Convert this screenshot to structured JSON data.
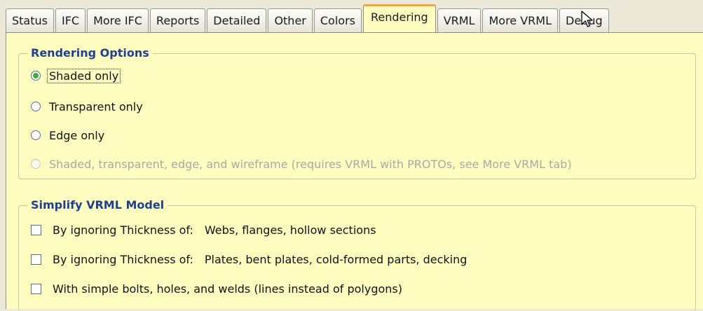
{
  "tabs": [
    {
      "label": "Status",
      "active": false
    },
    {
      "label": "IFC",
      "active": false
    },
    {
      "label": "More IFC",
      "active": false
    },
    {
      "label": "Reports",
      "active": false
    },
    {
      "label": "Detailed",
      "active": false
    },
    {
      "label": "Other",
      "active": false
    },
    {
      "label": "Colors",
      "active": false
    },
    {
      "label": "Rendering",
      "active": true
    },
    {
      "label": "VRML",
      "active": false
    },
    {
      "label": "More VRML",
      "active": false
    },
    {
      "label": "Debug",
      "active": false
    }
  ],
  "rendering_options": {
    "title": "Rendering Options",
    "options": [
      {
        "label": "Shaded only",
        "selected": true,
        "enabled": true
      },
      {
        "label": "Transparent only",
        "selected": false,
        "enabled": true
      },
      {
        "label": "Edge only",
        "selected": false,
        "enabled": true
      },
      {
        "label": "Shaded, transparent, edge, and wireframe (requires VRML with PROTOs, see More VRML tab)",
        "selected": false,
        "enabled": false
      }
    ]
  },
  "simplify_vrml": {
    "title": "Simplify VRML Model",
    "items": [
      {
        "prefix": "By ignoring Thickness of:",
        "detail": "Webs, flanges, hollow sections",
        "checked": false
      },
      {
        "prefix": "By ignoring Thickness of:",
        "detail": "Plates, bent plates, cold-formed parts, decking",
        "checked": false
      },
      {
        "prefix": "With simple bolts, holes, and welds (lines instead of polygons)",
        "detail": "",
        "checked": false
      }
    ]
  },
  "colors": {
    "panel_bg": "#fffec0",
    "legend": "#1f3f8f",
    "active_tab_accent": "#f2a53a",
    "radio_selected": "#3fae3f"
  }
}
